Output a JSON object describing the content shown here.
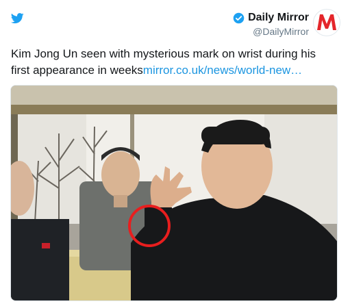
{
  "tweet": {
    "account": {
      "display_name": "Daily Mirror",
      "handle": "@DailyMirror",
      "verified": true,
      "avatar_letter": "M"
    },
    "text_body": "Kim Jong Un seen with mysterious mark on wrist during his first appearance in weeks",
    "link_text": "mirror.co.uk/news/world-new…",
    "icons": [
      "twitter-bird-icon",
      "verified-badge-icon"
    ]
  },
  "colors": {
    "twitter_blue": "#1da1f2",
    "link_blue": "#1b95e0",
    "mirror_red": "#e4262b",
    "highlight_circle": "#e81e1e"
  }
}
